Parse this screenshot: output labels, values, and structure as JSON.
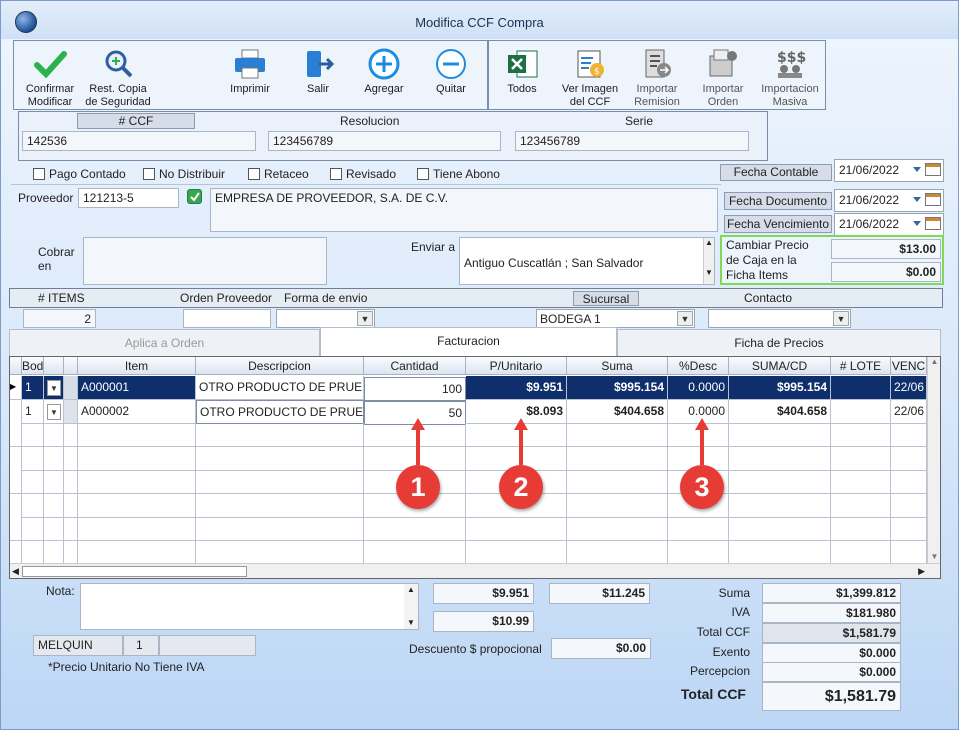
{
  "window": {
    "title": "Modifica CCF Compra"
  },
  "toolbar": {
    "confirm": "Confirmar\nModificar",
    "backup": "Rest. Copia\nde Seguridad",
    "print": "Imprimir",
    "exit": "Salir",
    "add": "Agregar",
    "remove": "Quitar",
    "all": "Todos",
    "view_image": "Ver Imagen\ndel CCF",
    "import_remision": "Importar\nRemision",
    "import_order": "Importar\nOrden",
    "mass_import": "Importacion\nMasiva"
  },
  "doc": {
    "ccf_label": "# CCF",
    "ccf_value": "142536",
    "resolucion_label": "Resolucion",
    "resolucion_value": "123456789",
    "serie_label": "Serie",
    "serie_value": "123456789"
  },
  "checks": [
    "Pago Contado",
    "No Distribuir",
    "Retaceo",
    "Revisado",
    "Tiene Abono"
  ],
  "dates": {
    "contable_label": "Fecha Contable",
    "contable": "21/06/2022",
    "documento_label": "Fecha Documento",
    "documento": "21/06/2022",
    "vencimiento_label": "Fecha Vencimiento",
    "vencimiento": "21/06/2022"
  },
  "proveedor": {
    "label": "Proveedor",
    "code": "121213-5",
    "name": "EMPRESA DE PROVEEDOR, S.A. DE C.V."
  },
  "cobrar": {
    "label": "Cobrar\nen"
  },
  "enviar": {
    "label": "Enviar a",
    "value": "Antiguo Cuscatlán ; San Salvador"
  },
  "precio_caja": {
    "label": "Cambiar Precio\nde Caja en la\nFicha Items",
    "value1": "$13.00",
    "value2": "$0.00"
  },
  "info": {
    "items_label": "# ITEMS",
    "items_value": "2",
    "orden_label": "Orden Proveedor",
    "orden_value": "",
    "envio_label": "Forma de envio",
    "envio_value": "",
    "sucursal_label": "Sucursal",
    "sucursal_value": "BODEGA 1",
    "contacto_label": "Contacto",
    "contacto_value": ""
  },
  "tabs": [
    "Aplica a Orden",
    "Facturacion",
    "Ficha de Precios"
  ],
  "grid": {
    "headers": [
      "Bodeg",
      "",
      "Item",
      "Descripcion",
      "Cantidad",
      "P/Unitario",
      "Suma",
      "%Desc",
      "SUMA/CD",
      "# LOTE",
      "VENC"
    ],
    "rows": [
      {
        "bodega": "1",
        "item": "A000001",
        "desc": "OTRO PRODUCTO DE PRUE",
        "cant": "100",
        "pu": "$9.951",
        "suma": "$995.154",
        "desc_pct": "0.0000",
        "sumacd": "$995.154",
        "lote": "",
        "venc": "22/06"
      },
      {
        "bodega": "1",
        "item": "A000002",
        "desc": "OTRO PRODUCTO DE PRUE",
        "cant": "50",
        "pu": "$8.093",
        "suma": "$404.658",
        "desc_pct": "0.0000",
        "sumacd": "$404.658",
        "lote": "",
        "venc": "22/06"
      }
    ]
  },
  "markers": [
    "1",
    "2",
    "3"
  ],
  "nota": {
    "label": "Nota:",
    "value": ""
  },
  "mid": {
    "v1": "$9.951",
    "v2": "$11.245",
    "v3": "$10.99",
    "descuento_label": "Descuento $ propocional",
    "descuento": "$0.00"
  },
  "user": {
    "name": "MELQUIN",
    "num": "1",
    "extra": ""
  },
  "note_iva": "*Precio Unitario No Tiene IVA",
  "totals": {
    "suma_label": "Suma",
    "suma": "$1,399.812",
    "iva_label": "IVA",
    "iva": "$181.980",
    "total_label": "Total CCF",
    "total": "$1,581.79",
    "exento_label": "Exento",
    "exento": "$0.000",
    "percepcion_label": "Percepcion",
    "percepcion": "$0.000",
    "grand_label": "Total CCF",
    "grand": "$1,581.79"
  },
  "colors": {
    "accent": "#0e2f6b",
    "marker": "#e63c35",
    "highlight_border": "#7ed957"
  }
}
